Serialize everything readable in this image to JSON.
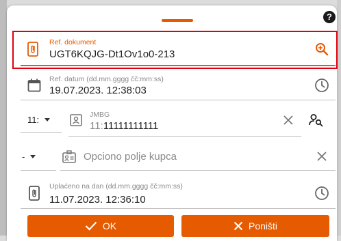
{
  "help_icon_glyph": "?",
  "ref_document": {
    "label": "Ref. dokument",
    "value": "UGT6KQJG-Dt1Ov1o0-213"
  },
  "ref_date": {
    "label": "Ref. datum (dd.mm.gggg čč:mm:ss)",
    "value": "19.07.2023. 12:38:03"
  },
  "jmbg": {
    "prefix": "11:",
    "label": "JMBG",
    "prefix_in_value": "11:",
    "value": "11111111111"
  },
  "optional_field": {
    "prefix": "-",
    "placeholder": "Opciono polje kupca"
  },
  "paid_on": {
    "label": "Uplaćeno na dan (dd.mm.gggg čč:mm:ss)",
    "value": "11.07.2023. 12:36:10"
  },
  "buttons": {
    "ok": "OK",
    "cancel": "Poništi"
  },
  "colors": {
    "accent": "#e65a00",
    "highlight_border": "#e0000f"
  }
}
